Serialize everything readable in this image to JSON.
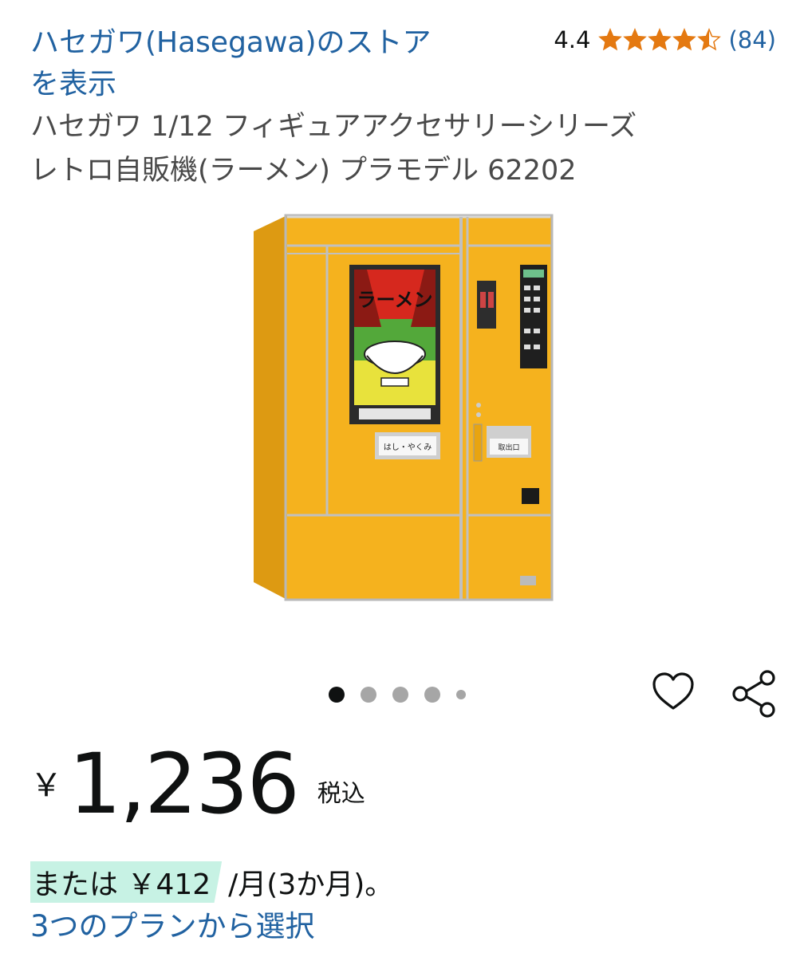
{
  "store": {
    "link_line1": "ハセガワ(Hasegawa)のストア",
    "link_line2": "を表示"
  },
  "rating": {
    "value": "4.4",
    "stars_filled": 4.5,
    "count": "(84)",
    "star_color": "#e47911"
  },
  "product": {
    "title_line1": "ハセガワ 1/12 フィギュアアクセサリーシリーズ",
    "title_line2": "レトロ自販機(ラーメン) プラモデル 62202",
    "image_icon": "vending-machine-image",
    "machine_sign": "ラーメン",
    "label_left": "はし・やくみ",
    "label_right": "取出口"
  },
  "carousel": {
    "count": 5,
    "active_index": 0
  },
  "actions": {
    "wishlist_icon": "heart-icon",
    "share_icon": "share-icon"
  },
  "price": {
    "symbol": "￥",
    "amount": "1,236",
    "tax_note": "税込"
  },
  "installment": {
    "prefix": "または ￥412",
    "suffix": "/月(3か月)。"
  },
  "plans": {
    "link_label": "3つのプランから選択"
  },
  "colors": {
    "link": "#2162a1",
    "highlight": "#c7f2e4",
    "machine": "#f5b21e"
  }
}
